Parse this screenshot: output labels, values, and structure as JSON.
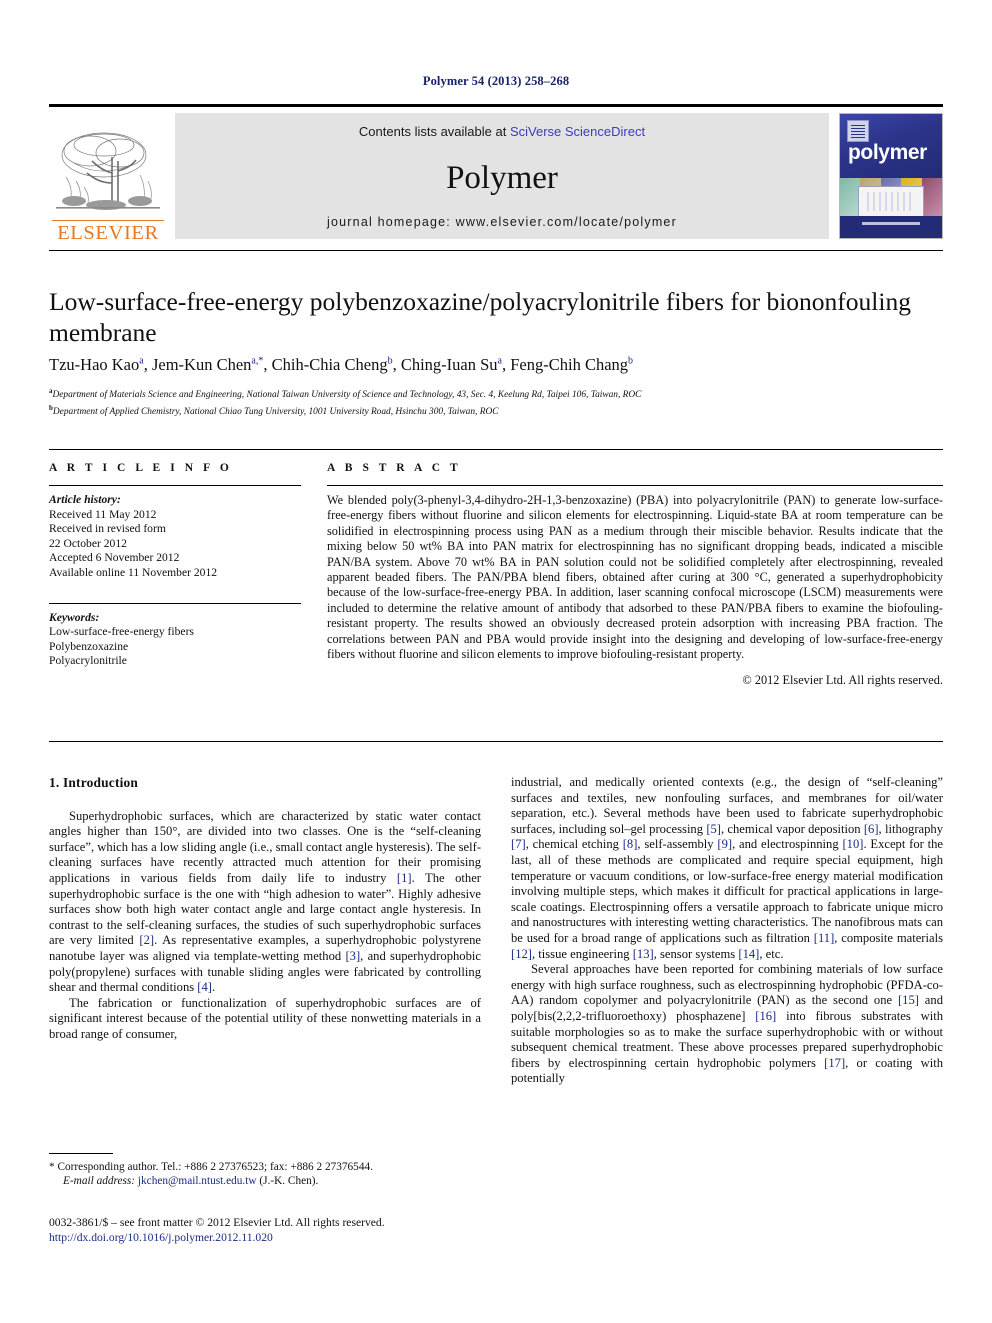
{
  "running_head": "Polymer 54 (2013) 258–268",
  "masthead": {
    "publisher": "ELSEVIER",
    "contents_prefix": "Contents lists available at ",
    "contents_link": "SciVerse ScienceDirect",
    "journal_name": "Polymer",
    "homepage": "journal homepage: www.elsevier.com/locate/polymer",
    "cover_title": "polymer",
    "brand_orange": "#e87722",
    "link_blue": "#3b3bbd",
    "band_gray": "#e3e3e3",
    "cover_navy": "#2a3287"
  },
  "article": {
    "title": "Low-surface-free-energy polybenzoxazine/polyacrylonitrile fibers for biononfouling membrane",
    "authors": [
      {
        "name": "Tzu-Hao Kao",
        "marks": "a"
      },
      {
        "name": "Jem-Kun Chen",
        "marks": "a,*"
      },
      {
        "name": "Chih-Chia Cheng",
        "marks": "b"
      },
      {
        "name": "Ching-Iuan Su",
        "marks": "a"
      },
      {
        "name": "Feng-Chih Chang",
        "marks": "b"
      }
    ],
    "affiliations": [
      {
        "mark": "a",
        "text": "Department of Materials Science and Engineering, National Taiwan University of Science and Technology, 43, Sec. 4, Keelung Rd, Taipei 106, Taiwan, ROC"
      },
      {
        "mark": "b",
        "text": "Department of Applied Chemistry, National Chiao Tung University, 1001 University Road, Hsinchu 300, Taiwan, ROC"
      }
    ]
  },
  "article_info": {
    "heading": "A R T I C L E   I N F O",
    "history_label": "Article history:",
    "history": [
      "Received 11 May 2012",
      "Received in revised form",
      "22 October 2012",
      "Accepted 6 November 2012",
      "Available online 11 November 2012"
    ],
    "keywords_label": "Keywords:",
    "keywords": [
      "Low-surface-free-energy fibers",
      "Polybenzoxazine",
      "Polyacrylonitrile"
    ]
  },
  "abstract": {
    "heading": "A B S T R A C T",
    "text": "We blended poly(3-phenyl-3,4-dihydro-2H-1,3-benzoxazine) (PBA) into polyacrylonitrile (PAN) to generate low-surface-free-energy fibers without fluorine and silicon elements for electrospinning. Liquid-state BA at room temperature can be solidified in electrospinning process using PAN as a medium through their miscible behavior. Results indicate that the mixing below 50 wt% BA into PAN matrix for electrospinning has no significant dropping beads, indicated a miscible PAN/BA system. Above 70 wt% BA in PAN solution could not be solidified completely after electrospinning, revealed apparent beaded fibers. The PAN/PBA blend fibers, obtained after curing at 300 °C, generated a superhydrophobicity because of the low-surface-free-energy PBA. In addition, laser scanning confocal microscope (LSCM) measurements were included to determine the relative amount of antibody that adsorbed to these PAN/PBA fibers to examine the biofouling-resistant property. The results showed an obviously decreased protein adsorption with increasing PBA fraction. The correlations between PAN and PBA would provide insight into the designing and developing of low-surface-free-energy fibers without fluorine and silicon elements to improve biofouling-resistant property.",
    "copyright": "© 2012 Elsevier Ltd. All rights reserved."
  },
  "body": {
    "section_heading": "1. Introduction",
    "left_paragraph_1_a": "Superhydrophobic surfaces, which are characterized by static water contact angles higher than 150",
    "left_paragraph_1_b": ", are divided into two classes. One is the “self-cleaning surface”, which has a low sliding angle (i.e., small contact angle hysteresis). The self-cleaning surfaces have recently attracted much attention for their promising applications in various fields from daily life to industry ",
    "ref1": "[1]",
    "left_paragraph_1_c": ". The other superhydrophobic surface is the one with “high adhesion to water”. Highly adhesive surfaces show both high water contact angle and large contact angle hysteresis. In contrast to the self-cleaning surfaces, the studies of such superhydrophobic surfaces are very limited ",
    "ref2": "[2]",
    "left_paragraph_1_d": ". As representative examples, a superhydrophobic polystyrene nanotube layer was aligned via template-wetting method ",
    "ref3": "[3]",
    "left_paragraph_1_e": ", and superhydrophobic poly(propylene) surfaces with tunable sliding angles were fabricated by controlling shear and thermal conditions ",
    "ref4": "[4]",
    "left_paragraph_1_f": ".",
    "left_paragraph_2": "The fabrication or functionalization of superhydrophobic surfaces are of significant interest because of the potential utility of these nonwetting materials in a broad range of consumer,",
    "right_paragraph_1_a": "industrial, and medically oriented contexts (e.g., the design of “self-cleaning” surfaces and textiles, new nonfouling surfaces, and membranes for oil/water separation, etc.). Several methods have been used to fabricate superhydrophobic surfaces, including sol–gel processing ",
    "ref5": "[5]",
    "right_paragraph_1_b": ", chemical vapor deposition ",
    "ref6": "[6]",
    "right_paragraph_1_c": ", lithography ",
    "ref7": "[7]",
    "right_paragraph_1_d": ", chemical etching ",
    "ref8": "[8]",
    "right_paragraph_1_e": ", self-assembly ",
    "ref9": "[9]",
    "right_paragraph_1_f": ", and electrospinning ",
    "ref10": "[10]",
    "right_paragraph_1_g": ". Except for the last, all of these methods are complicated and require special equipment, high temperature or vacuum conditions, or low-surface-free energy material modification involving multiple steps, which makes it difficult for practical applications in large-scale coatings. Electrospinning offers a versatile approach to fabricate unique micro and nanostructures with interesting wetting characteristics. The nanofibrous mats can be used for a broad range of applications such as filtration ",
    "ref11": "[11]",
    "right_paragraph_1_h": ", composite materials ",
    "ref12": "[12]",
    "right_paragraph_1_i": ", tissue engineering ",
    "ref13": "[13]",
    "right_paragraph_1_j": ", sensor systems ",
    "ref14": "[14]",
    "right_paragraph_1_k": ", etc.",
    "right_paragraph_2_a": "Several approaches have been reported for combining materials of low surface energy with high surface roughness, such as electrospinning hydrophobic (PFDA-co-AA) random copolymer and polyacrylonitrile (PAN) as the second one ",
    "ref15": "[15]",
    "right_paragraph_2_b": " and poly[bis(2,2,2-trifluoroethoxy) phosphazene] ",
    "ref16": "[16]",
    "right_paragraph_2_c": " into fibrous substrates with suitable morphologies so as to make the surface superhydrophobic with or without subsequent chemical treatment. These above processes prepared superhydrophobic fibers by electrospinning certain hydrophobic polymers ",
    "ref17": "[17]",
    "right_paragraph_2_d": ", or coating with potentially"
  },
  "footnote": {
    "corresponding": "* Corresponding author. Tel.: +886 2 27376523; fax: +886 2 27376544.",
    "email_label": "E-mail address:",
    "email": "jkchen@mail.ntust.edu.tw",
    "email_suffix": "(J.-K. Chen)."
  },
  "imprint": {
    "line1": "0032-3861/$ – see front matter © 2012 Elsevier Ltd. All rights reserved.",
    "doi": "http://dx.doi.org/10.1016/j.polymer.2012.11.020"
  }
}
